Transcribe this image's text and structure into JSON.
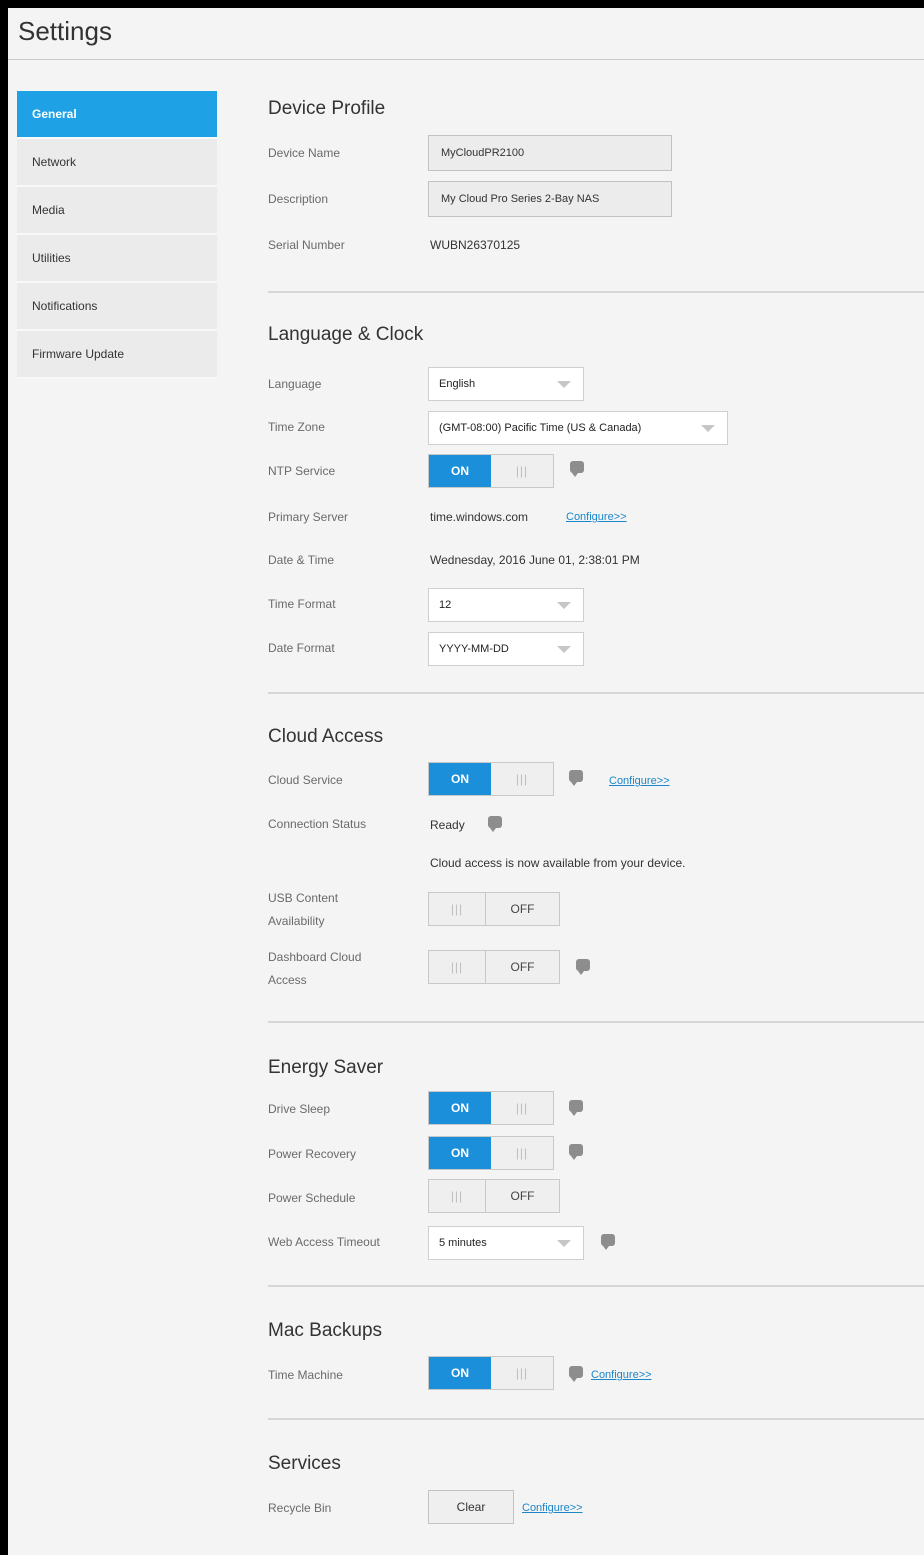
{
  "title": "Settings",
  "sidebar": {
    "items": [
      {
        "label": "General"
      },
      {
        "label": "Network"
      },
      {
        "label": "Media"
      },
      {
        "label": "Utilities"
      },
      {
        "label": "Notifications"
      },
      {
        "label": "Firmware Update"
      }
    ],
    "active_index": 0
  },
  "device_profile": {
    "title": "Device Profile",
    "device_name_label": "Device Name",
    "device_name_value": "MyCloudPR2100",
    "description_label": "Description",
    "description_value": "My Cloud Pro Series 2-Bay NAS",
    "serial_label": "Serial Number",
    "serial_value": "WUBN26370125"
  },
  "language_clock": {
    "title": "Language & Clock",
    "language_label": "Language",
    "language_value": "English",
    "timezone_label": "Time Zone",
    "timezone_value": "(GMT-08:00) Pacific Time (US & Canada)",
    "ntp_label": "NTP Service",
    "ntp_state": "ON",
    "primary_server_label": "Primary Server",
    "primary_server_value": "time.windows.com",
    "configure_link": "Configure>>",
    "datetime_label": "Date & Time",
    "datetime_value": "Wednesday, 2016 June 01, 2:38:01 PM",
    "time_format_label": "Time Format",
    "time_format_value": "12",
    "date_format_label": "Date Format",
    "date_format_value": "YYYY-MM-DD"
  },
  "cloud_access": {
    "title": "Cloud Access",
    "cloud_service_label": "Cloud Service",
    "cloud_service_state": "ON",
    "configure_link": "Configure>>",
    "connection_status_label": "Connection Status",
    "connection_status_value": "Ready",
    "status_message": "Cloud access is now available from your device.",
    "usb_label_line1": "USB Content",
    "usb_label_line2": "Availability",
    "usb_state": "OFF",
    "dashboard_label_line1": "Dashboard Cloud",
    "dashboard_label_line2": "Access",
    "dashboard_state": "OFF"
  },
  "energy_saver": {
    "title": "Energy Saver",
    "drive_sleep_label": "Drive Sleep",
    "drive_sleep_state": "ON",
    "power_recovery_label": "Power Recovery",
    "power_recovery_state": "ON",
    "power_schedule_label": "Power Schedule",
    "power_schedule_state": "OFF",
    "web_timeout_label": "Web Access Timeout",
    "web_timeout_value": "5 minutes"
  },
  "mac_backups": {
    "title": "Mac Backups",
    "time_machine_label": "Time Machine",
    "time_machine_state": "ON",
    "configure_link": "Configure>>"
  },
  "services": {
    "title": "Services",
    "recycle_bin_label": "Recycle Bin",
    "clear_label": "Clear",
    "configure_link": "Configure>>"
  },
  "toggle_grip": "|||",
  "colors": {
    "accent": "#1fa1e6",
    "toggle_on": "#1b8fd9",
    "link": "#1b86c8"
  }
}
